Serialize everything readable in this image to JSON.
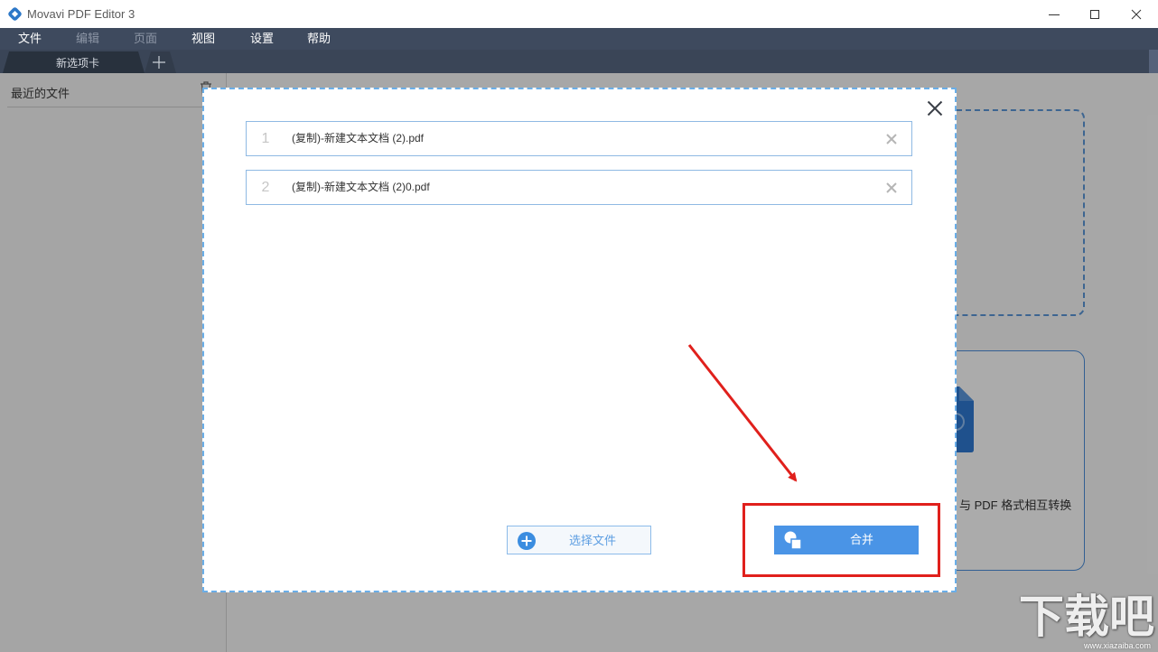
{
  "window": {
    "title": "Movavi PDF Editor 3",
    "logo_icon": "movavi-logo-icon",
    "minimize_icon": "minimize-icon",
    "maximize_icon": "maximize-icon",
    "close_icon": "close-icon"
  },
  "menu": [
    {
      "label": "文件",
      "enabled": true
    },
    {
      "label": "编辑",
      "enabled": false
    },
    {
      "label": "页面",
      "enabled": false
    },
    {
      "label": "视图",
      "enabled": true
    },
    {
      "label": "设置",
      "enabled": true
    },
    {
      "label": "帮助",
      "enabled": true
    }
  ],
  "tabs": {
    "items": [
      {
        "label": "新选项卡",
        "active": true
      }
    ],
    "add_icon": "plus-icon"
  },
  "sidebar": {
    "title": "最近的文件",
    "delete_icon": "trash-icon"
  },
  "start_page": {
    "convert_card_text": "与 PDF 格式相互转换",
    "convert_card_icon": "document-icon"
  },
  "merge_dialog": {
    "close_icon": "close-icon",
    "files": [
      {
        "index": "1",
        "name": "(复制)-新建文本文档 (2).pdf",
        "remove_icon": "remove-icon"
      },
      {
        "index": "2",
        "name": "(复制)-新建文本文档 (2)0.pdf",
        "remove_icon": "remove-icon"
      }
    ],
    "select_files_button": {
      "label": "选择文件",
      "icon": "plus-circle-icon"
    },
    "merge_button": {
      "label": "合并",
      "icon": "shapes-icon"
    }
  },
  "watermark": {
    "logo_text": "下载吧",
    "url": "www.xiazaiba.com"
  },
  "colors": {
    "menu_bar": "#3e4a5e",
    "tab_bar": "#3a4557",
    "accent": "#4a94e6",
    "dialog_border": "#6aaee8",
    "annotation": "#e0201c"
  }
}
